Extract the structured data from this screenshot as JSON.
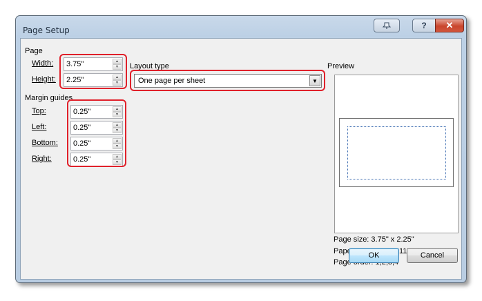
{
  "window": {
    "title": "Page Setup"
  },
  "caption_buttons": {
    "pin_icon": "pin-icon",
    "help_label": "?",
    "close_label": "✕"
  },
  "page": {
    "section_label": "Page",
    "width": {
      "label": "Width:",
      "value": "3.75\""
    },
    "height": {
      "label": "Height:",
      "value": "2.25\""
    }
  },
  "margins": {
    "section_label": "Margin guides",
    "top": {
      "label": "Top:",
      "value": "0.25\""
    },
    "left": {
      "label": "Left:",
      "value": "0.25\""
    },
    "bottom": {
      "label": "Bottom:",
      "value": "0.25\""
    },
    "right": {
      "label": "Right:",
      "value": "0.25\""
    }
  },
  "layout": {
    "label": "Layout type",
    "selected": "One page per sheet"
  },
  "preview": {
    "label": "Preview",
    "page_size": "Page size: 3.75\" x 2.25\"",
    "paper_size": "Paper size: 3.75\" x 11\"",
    "page_order": "Page order: 1,2,3,4"
  },
  "buttons": {
    "ok": "OK",
    "cancel": "Cancel"
  },
  "colors": {
    "highlight": "#e0202a",
    "title_bar": "#bcd0e5",
    "client": "#f0f0f0"
  }
}
